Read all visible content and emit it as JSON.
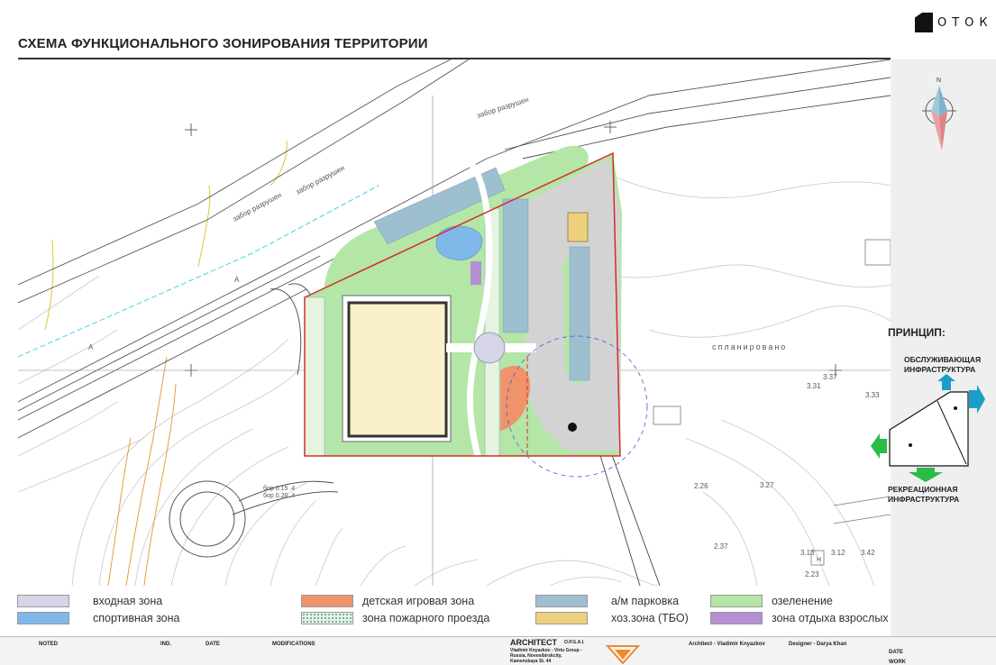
{
  "header": {
    "title": "СХЕМА ФУНКЦИОНАЛЬНОГО ЗОНИРОВАНИЯ ТЕРРИТОРИИ",
    "logo_text": "ОТОК"
  },
  "compass": {
    "north_label": "N"
  },
  "plan_labels": {
    "fence_1": "забор разрушен",
    "fence_2": "забор разрушен",
    "fence_3": "забор разрушен",
    "planned": "спланировано",
    "level_1": "3.37",
    "level_2": "3.31",
    "level_3": "3.33",
    "level_4": "3.27",
    "level_5": "2.26",
    "level_6": "3.13",
    "level_7": "3.12",
    "level_8": "3.42",
    "level_9": "2.37",
    "level_10": "2.23",
    "mark_h": "Н",
    "mark_a1": "А",
    "mark_a2": "А",
    "road_note": "бор 0.15 .4",
    "road_note2": "бор 0.20 .4"
  },
  "principle": {
    "title": "ПРИНЦИП:",
    "top_label_1": "ОБСЛУЖИВАЮЩАЯ",
    "top_label_2": "ИНФРАСТРУКТУРА",
    "bottom_label_1": "РЕКРЕАЦИОННАЯ",
    "bottom_label_2": "ИНФРАСТРУКТУРА"
  },
  "legend": {
    "items": [
      {
        "label": "входная зона",
        "color": "#d6d4e8"
      },
      {
        "label": "спортивная зона",
        "color": "#7fb9ea"
      },
      {
        "label": "детская игровая зона",
        "color": "#f0936b"
      },
      {
        "label": "зона пожарного проезда",
        "color": "#e7f3e1"
      },
      {
        "label": "а/м парковка",
        "color": "#9ebfcf"
      },
      {
        "label": "хоз.зона (ТБО)",
        "color": "#ecd07e"
      },
      {
        "label": "озеленение",
        "color": "#b4e6a8"
      },
      {
        "label": "зона отдыха взрослых",
        "color": "#b48fd4"
      }
    ]
  },
  "footer": {
    "noted": "NOTED",
    "ind": "IND.",
    "date": "DATE",
    "modifications": "MODIFICATIONS",
    "architect": "ARCHITECT",
    "architect_sub": "O.P.G.A.I.",
    "architect_line1": "Vladimir Knyazkov - Virtu Group -",
    "architect_line2": "Russia, Novosibirskcity,",
    "architect_line3": "Kamenskaya St. 44",
    "architect_name": "Architect - Vladimir Knyazkov",
    "designer": "Designer - Darya Khan",
    "date_right": "DATE",
    "work_right": "WORK"
  },
  "colors": {
    "green": "#b4e6a8",
    "parking": "#9ebfcf",
    "gray": "#d3d3d3",
    "sport_fill": "#fbf1c8",
    "red_boundary": "#d62b2b",
    "arrow_blue": "#1a9ec9",
    "arrow_green": "#2bbb47"
  }
}
